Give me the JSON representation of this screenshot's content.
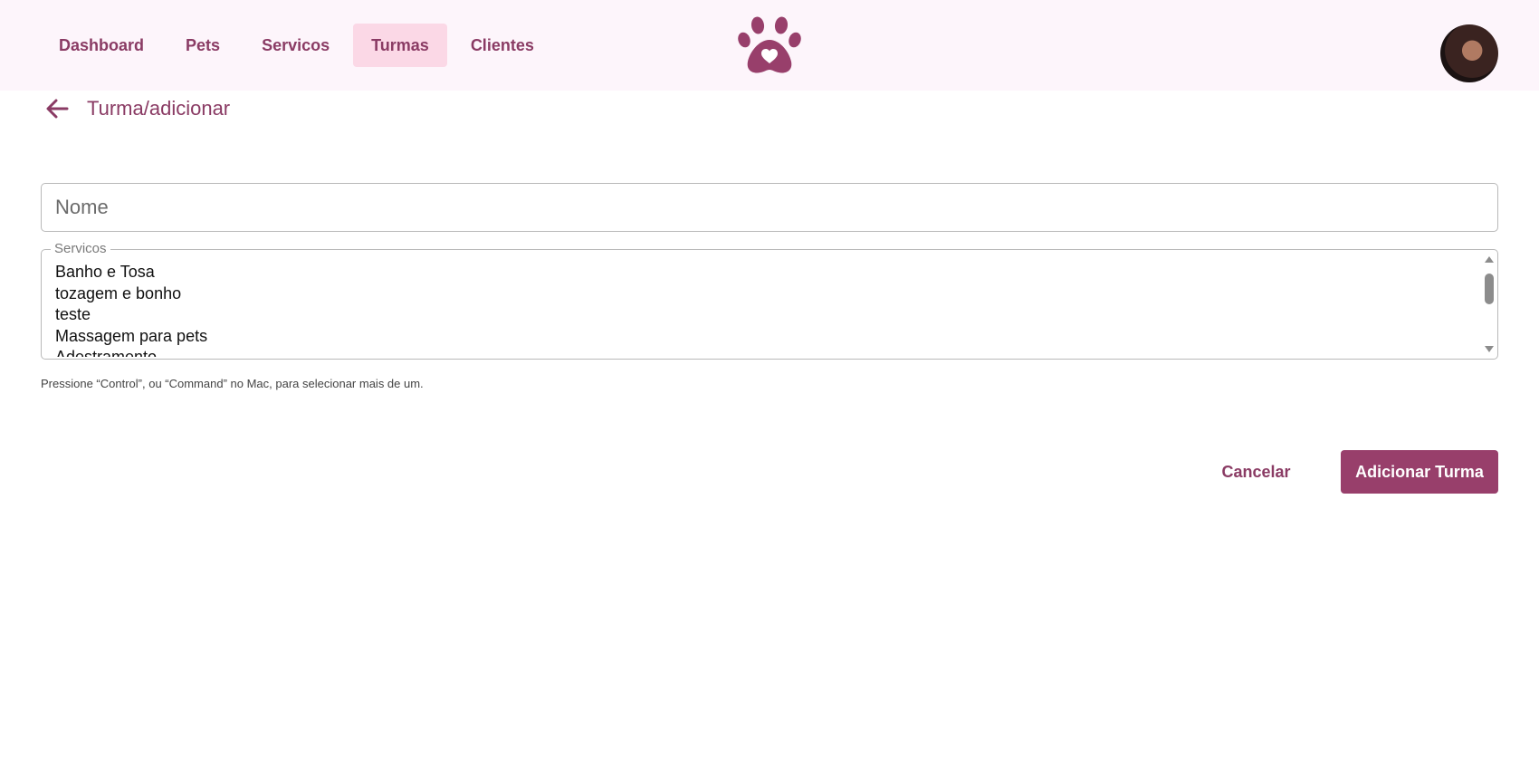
{
  "nav": {
    "items": [
      {
        "label": "Dashboard",
        "active": false
      },
      {
        "label": "Pets",
        "active": false
      },
      {
        "label": "Servicos",
        "active": false
      },
      {
        "label": "Turmas",
        "active": true
      },
      {
        "label": "Clientes",
        "active": false
      }
    ]
  },
  "logo": {
    "icon": "paw-heart-icon",
    "color": "#983f6b"
  },
  "breadcrumb": {
    "text": "Turma/adicionar",
    "icon": "arrow-left-icon"
  },
  "form": {
    "name_placeholder": "Nome",
    "name_value": "",
    "services_label": "Servicos",
    "services_options": [
      "Banho e Tosa",
      "tozagem e bonho",
      "teste",
      "Massagem para pets",
      "Adestramento"
    ],
    "help_text": "Pressione “Control”, ou “Command” no Mac, para selecionar mais de um."
  },
  "actions": {
    "cancel_label": "Cancelar",
    "submit_label": "Adicionar Turma"
  },
  "colors": {
    "accent": "#983f6b",
    "nav_text": "#8a3b64",
    "active_tab_bg": "#fbd8e6",
    "topbar_bg": "#fdf5fb"
  }
}
